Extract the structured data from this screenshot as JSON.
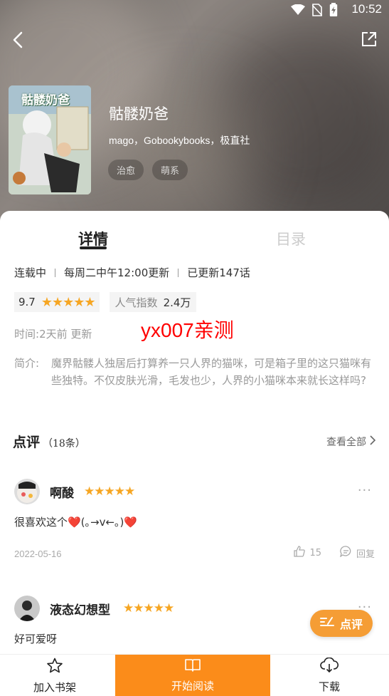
{
  "status": {
    "time": "10:52"
  },
  "book": {
    "title": "骷髅奶爸",
    "authors": "mago，Gobookybooks，极直社",
    "tags": [
      "治愈",
      "萌系"
    ],
    "cover_title": "骷髅奶爸"
  },
  "tabs": {
    "detail": "详情",
    "toc": "目录"
  },
  "meta": {
    "status": "连载中",
    "schedule": "每周二中午12:00更新",
    "updated": "已更新147话"
  },
  "score": {
    "value": "9.7",
    "stars": "★★★★★",
    "rating": 5
  },
  "popularity": {
    "label": "人气指数",
    "value": "2.4万"
  },
  "time": {
    "label": "时间:",
    "value": "2天前 更新"
  },
  "watermark": "yx007亲测",
  "intro": {
    "label": "简介:",
    "text": "魔界骷髅人独居后打算养一只人界的猫咪，可是箱子里的这只猫咪有些独特。不仅皮肤光滑，毛发也少，人界的小猫咪本来就长这样吗?"
  },
  "reviews": {
    "title": "点评",
    "count": "（18条）",
    "view_all": "查看全部",
    "items": [
      {
        "name": "啊酸",
        "stars": "★★★★★",
        "rating": 5,
        "text": "很喜欢这个❤️(｡→v←｡)❤️",
        "date": "2022-05-16",
        "likes": "15",
        "reply": "回复",
        "more": "···"
      },
      {
        "name": "液态幻想型",
        "stars": "★★★★★",
        "rating": 5,
        "text": "好可爱呀",
        "more": "···"
      }
    ]
  },
  "fab": {
    "label": "点评"
  },
  "bottom": {
    "shelf": "加入书架",
    "read": "开始阅读",
    "download": "下载"
  },
  "colors": {
    "accent": "#fb8c1a",
    "star": "#f6a623",
    "watermark": "#ff0000"
  }
}
